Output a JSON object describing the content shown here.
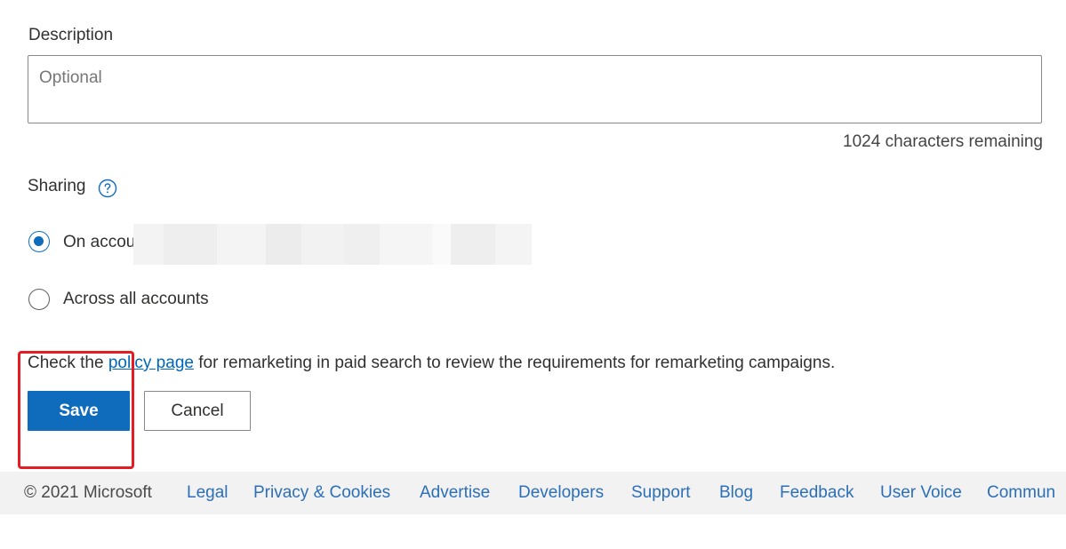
{
  "description": {
    "label": "Description",
    "placeholder": "Optional",
    "value": "",
    "chars_remaining": "1024 characters remaining"
  },
  "sharing": {
    "label": "Sharing",
    "help_icon": "question-circle-icon",
    "options": [
      {
        "label": "On accou",
        "selected": true,
        "redacted": true
      },
      {
        "label": "Across all accounts",
        "selected": false
      }
    ]
  },
  "policy": {
    "prefix": "Check the ",
    "link_text": "policy page",
    "suffix": " for remarketing in paid search to review the requirements for remarketing campaigns."
  },
  "actions": {
    "save_label": "Save",
    "cancel_label": "Cancel"
  },
  "footer": {
    "copyright": "© 2021 Microsoft",
    "links": [
      "Legal",
      "Privacy & Cookies",
      "Advertise",
      "Developers",
      "Support",
      "Blog",
      "Feedback",
      "User Voice",
      "Commun"
    ]
  },
  "colors": {
    "primary": "#0f6cbd",
    "link": "#0067b8",
    "highlight": "#e51c23",
    "footer_bg": "#f2f2f2"
  }
}
